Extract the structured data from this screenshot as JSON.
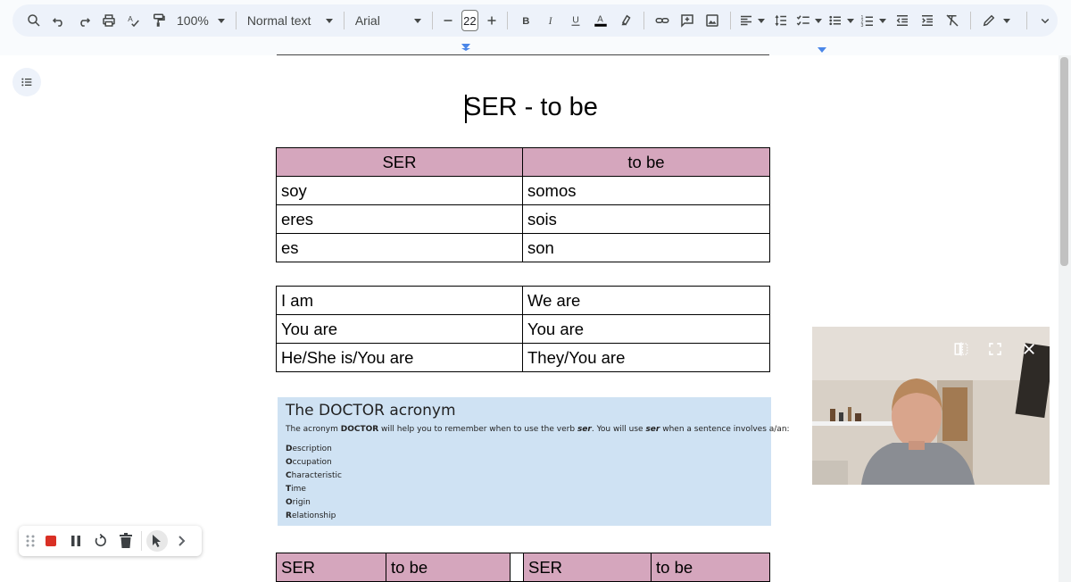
{
  "toolbar": {
    "zoom": "100%",
    "style": "Normal text",
    "font": "Arial",
    "font_size": "22"
  },
  "document": {
    "title": "SER - to be",
    "table1": {
      "header": [
        "SER",
        "to be"
      ],
      "rows": [
        [
          "soy",
          "somos"
        ],
        [
          "eres",
          "sois"
        ],
        [
          "es",
          "son"
        ]
      ]
    },
    "table2": {
      "rows": [
        [
          "I am",
          "We are"
        ],
        [
          "You are",
          "You are"
        ],
        [
          "He/She is/You are",
          "They/You are"
        ]
      ]
    },
    "doctor": {
      "title": "The DOCTOR acronym",
      "sub_a": "The acronym ",
      "sub_b": "DOCTOR",
      "sub_c": " will help you to remember when to use the verb ",
      "sub_d": "ser",
      "sub_e": ". You will use ",
      "sub_f": "ser",
      "sub_g": " when a sentence involves a/an:",
      "items": [
        {
          "initial": "D",
          "rest": "escription"
        },
        {
          "initial": "O",
          "rest": "ccupation"
        },
        {
          "initial": "C",
          "rest": "haracteristic"
        },
        {
          "initial": "T",
          "rest": "ime"
        },
        {
          "initial": "O",
          "rest": "rigin"
        },
        {
          "initial": "R",
          "rest": "elationship"
        }
      ]
    },
    "table3": [
      "SER",
      "to be",
      "",
      "SER",
      "to be"
    ]
  },
  "colors": {
    "table_header": "#d5a6bd",
    "doctor_bg": "#cfe2f3",
    "toolbar_bg": "#edf2fa",
    "record_red": "#d93025"
  }
}
